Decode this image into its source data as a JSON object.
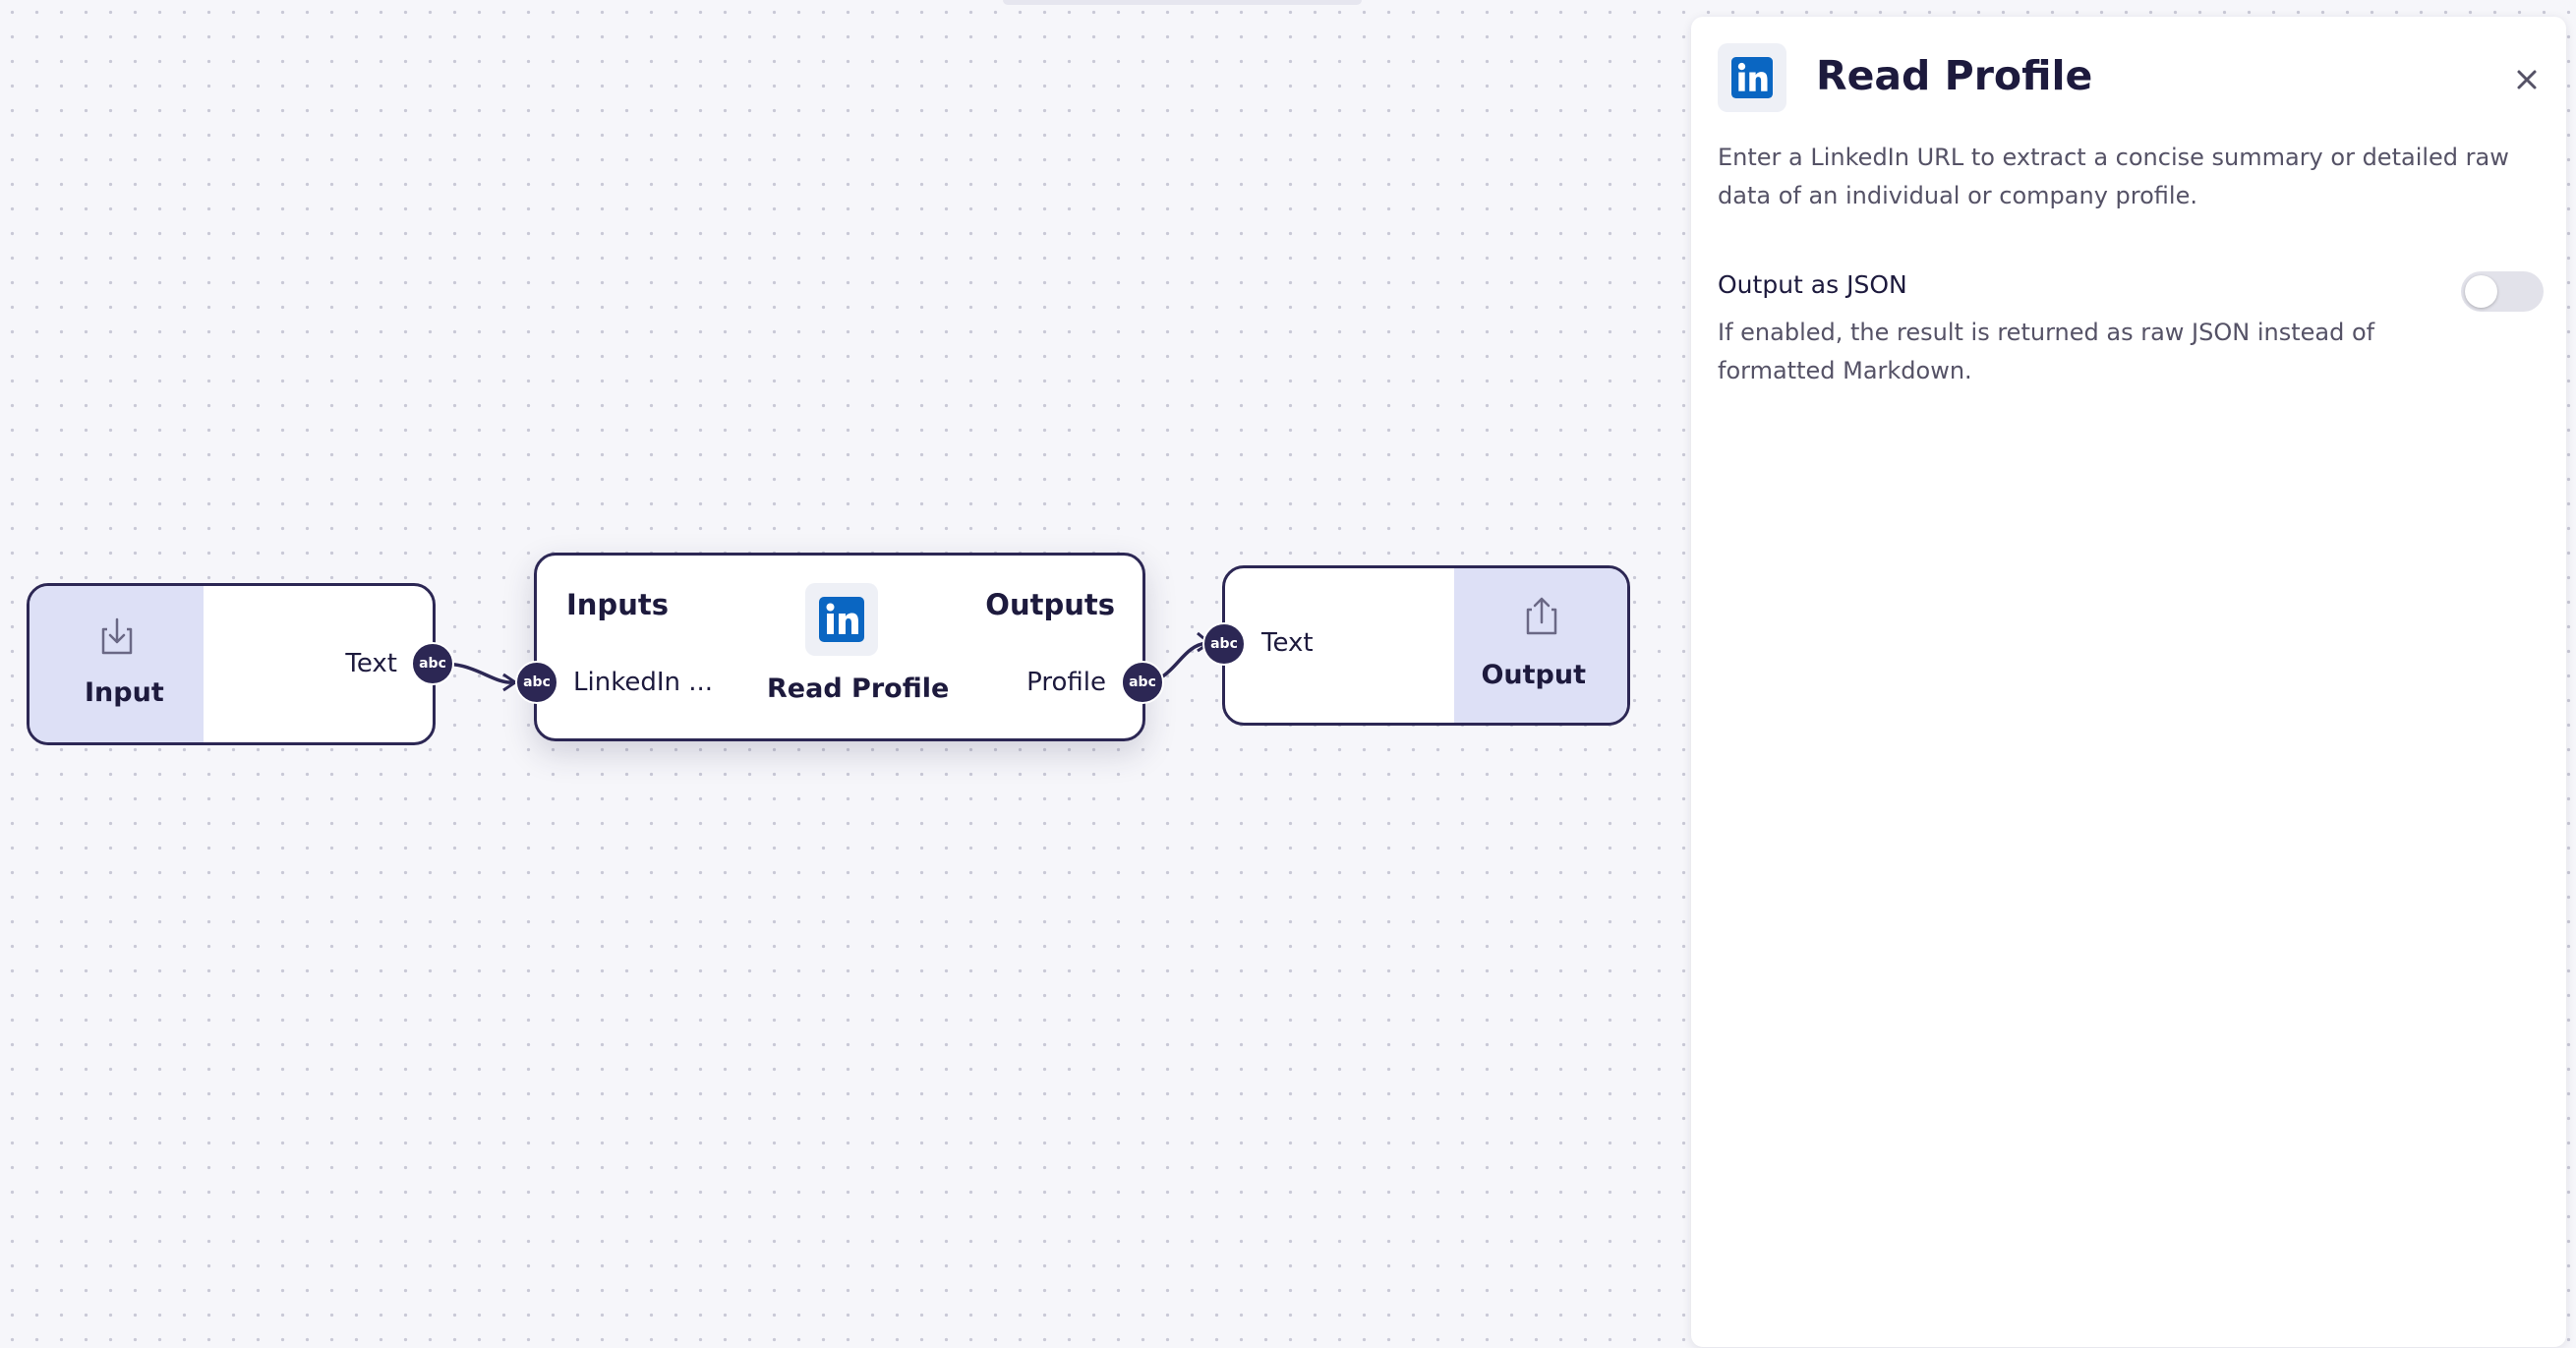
{
  "canvas": {
    "input_node": {
      "title": "Input",
      "port_label": "Text",
      "port_type": "abc",
      "icon": "download-icon"
    },
    "read_node": {
      "inputs_heading": "Inputs",
      "outputs_heading": "Outputs",
      "title": "Read Profile",
      "input_label": "LinkedIn ...",
      "output_label": "Profile",
      "input_port_type": "abc",
      "output_port_type": "abc",
      "icon": "linkedin-icon"
    },
    "output_node": {
      "title": "Output",
      "port_label": "Text",
      "port_type": "abc",
      "icon": "upload-icon"
    }
  },
  "panel": {
    "icon": "linkedin-icon",
    "title": "Read Profile",
    "close_icon": "close-icon",
    "description": "Enter a LinkedIn URL to extract a concise summary or detailed raw data of an individual or company profile.",
    "options": [
      {
        "label": "Output as JSON",
        "help": "If enabled, the result is returned as raw JSON instead of formatted Markdown.",
        "enabled": false
      }
    ]
  },
  "colors": {
    "node_border": "#2c2754",
    "node_accent": "#dde0f6",
    "port": "#2c2754",
    "linkedin_blue": "#0a66c2",
    "canvas_bg": "#f6f6fa"
  }
}
